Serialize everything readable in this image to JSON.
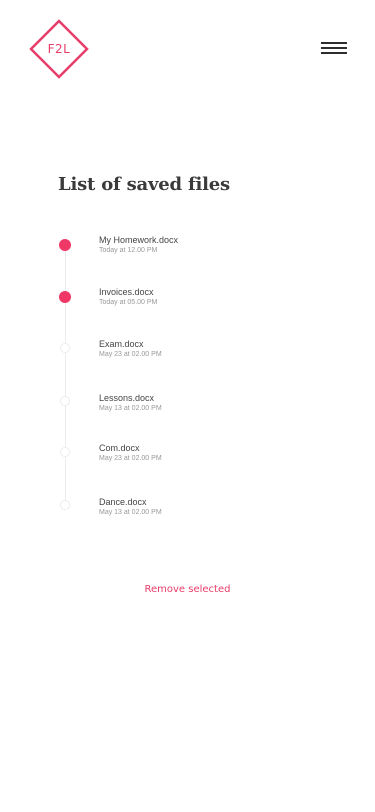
{
  "header": {
    "logo_text": "F2L",
    "menu_icon": "hamburger-menu-icon"
  },
  "main": {
    "title": "List of saved files",
    "files": [
      {
        "name": "My Homework.docx",
        "date": "Today at 12.00 PM",
        "selected": true
      },
      {
        "name": "Invoices.docx",
        "date": "Today at 05.00 PM",
        "selected": true
      },
      {
        "name": "Exam.docx",
        "date": "May 23 at 02.00 PM",
        "selected": false
      },
      {
        "name": "Lessons.docx",
        "date": "May 13 at 02.00 PM",
        "selected": false
      },
      {
        "name": "Com.docx",
        "date": "May 23 at 02.00 PM",
        "selected": false
      },
      {
        "name": "Dance.docx",
        "date": "May 13 at 02.00 PM",
        "selected": false
      }
    ],
    "remove_label": "Remove selected"
  },
  "colors": {
    "accent": "#e83d6a",
    "selected_dot": "#f03867",
    "unselected_dot_border": "#ececec"
  }
}
